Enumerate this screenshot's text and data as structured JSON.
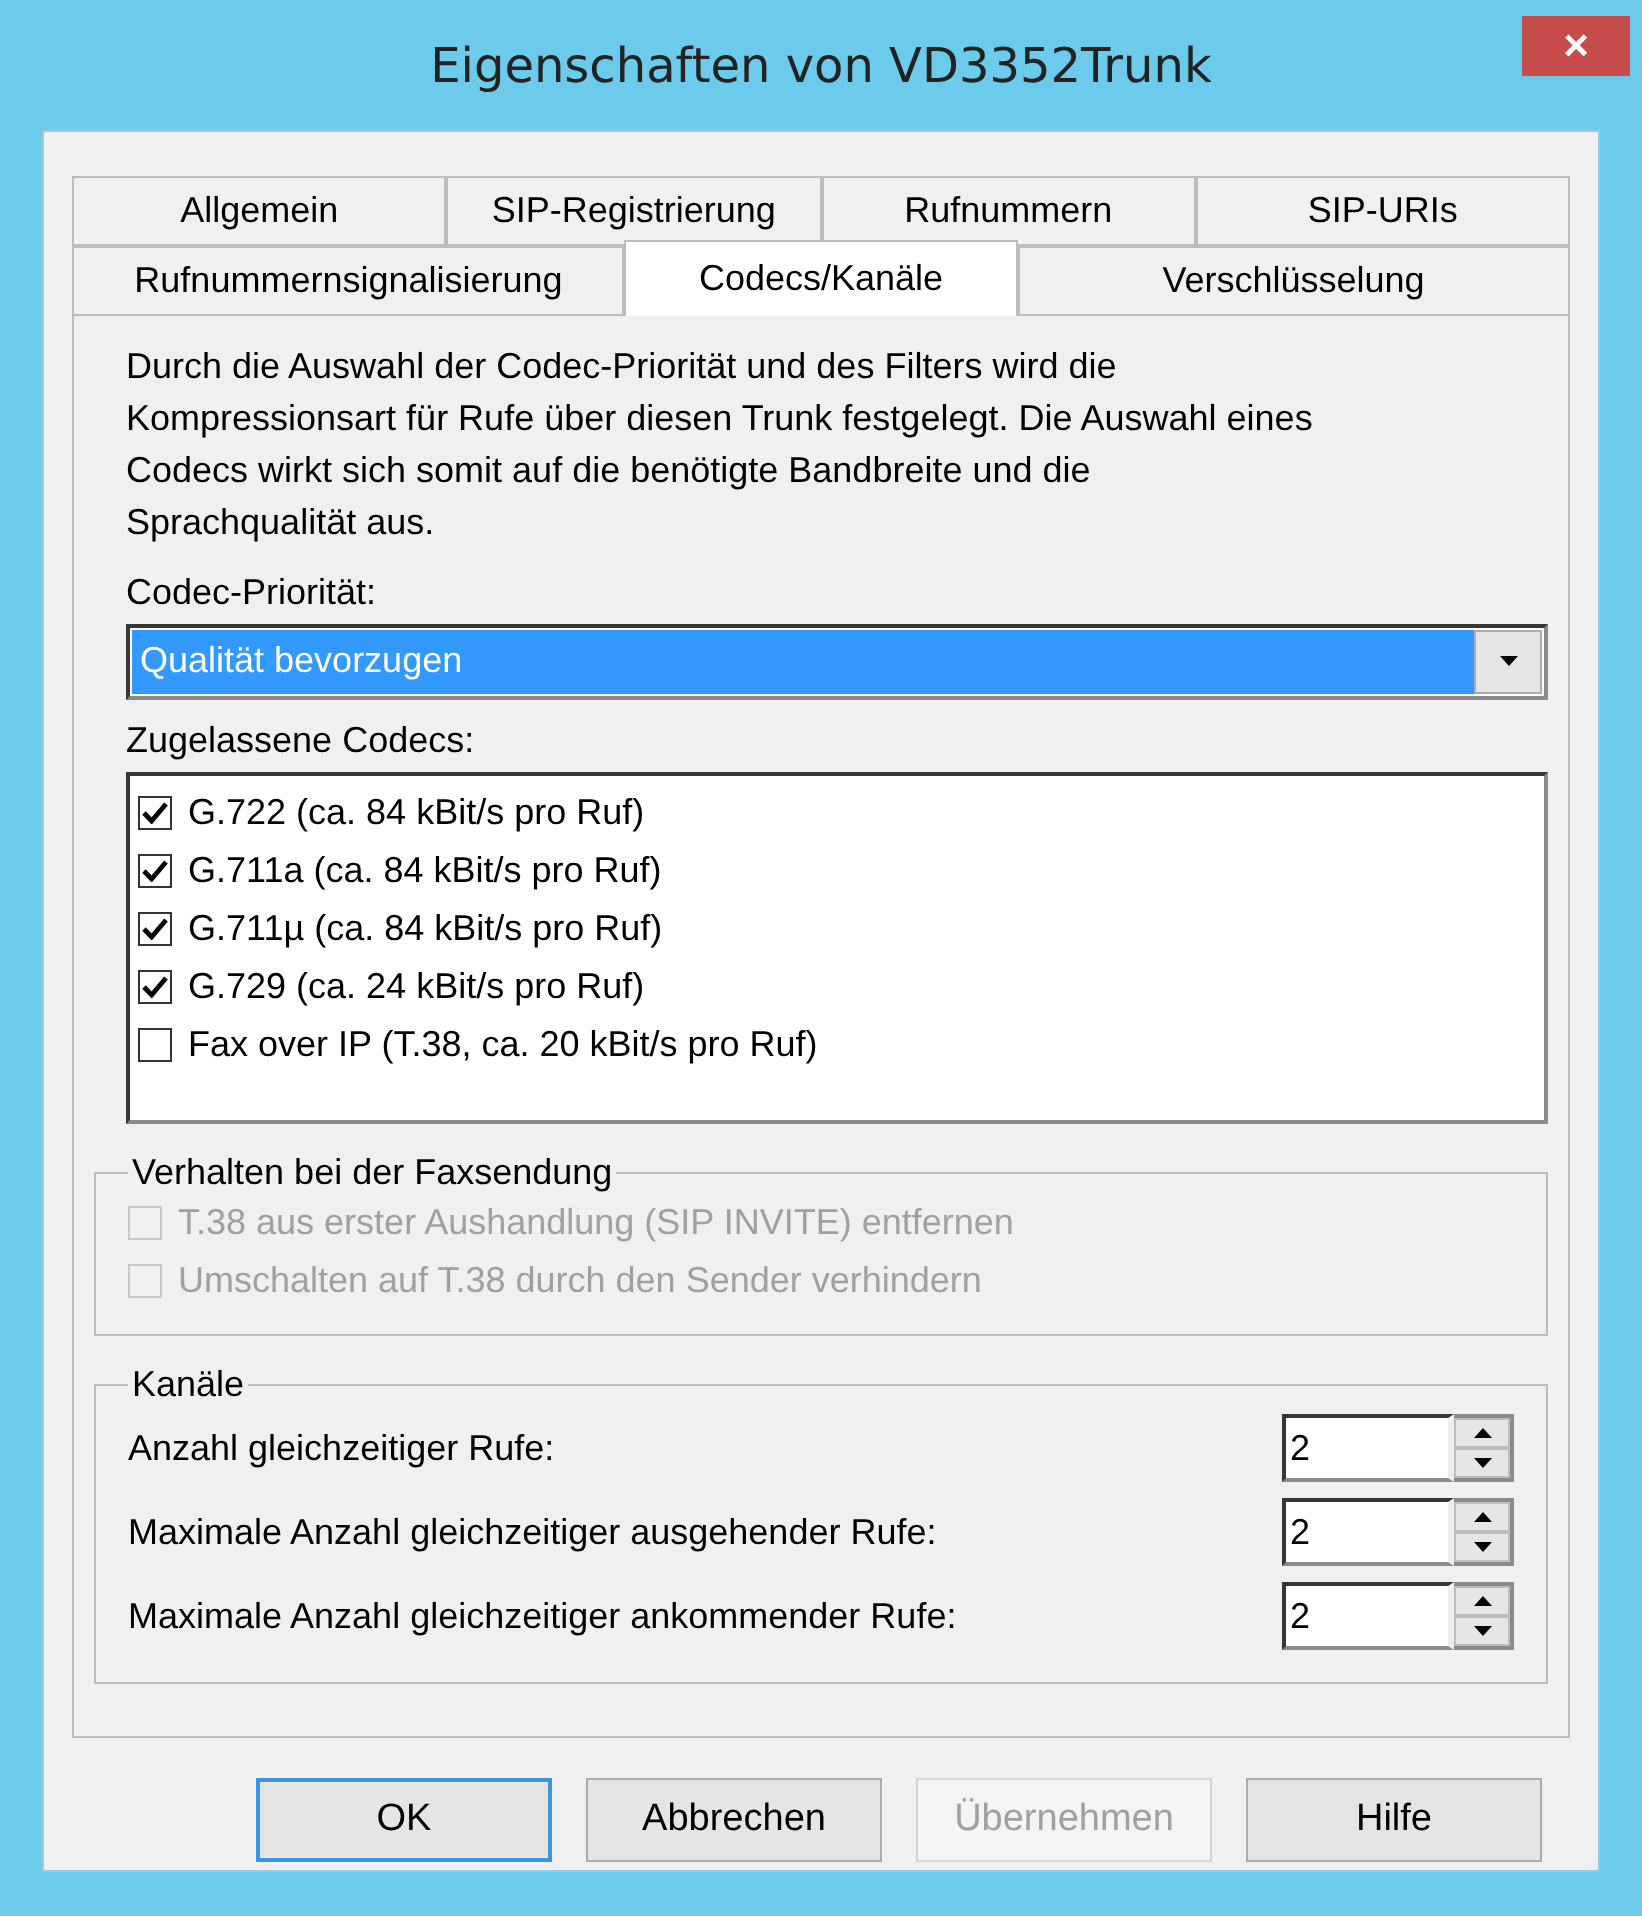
{
  "window": {
    "title": "Eigenschaften von VD3352Trunk",
    "close": "×"
  },
  "tab_rows": [
    [
      {
        "label": "Allgemein",
        "selected": false
      },
      {
        "label": "SIP-Registrierung",
        "selected": false
      },
      {
        "label": "Rufnummern",
        "selected": false
      },
      {
        "label": "SIP-URIs",
        "selected": false
      }
    ],
    [
      {
        "label": "Rufnummernsignalisierung",
        "selected": false
      },
      {
        "label": "Codecs/Kanäle",
        "selected": true
      },
      {
        "label": "Verschlüsselung",
        "selected": false
      }
    ]
  ],
  "description": "Durch die Auswahl der Codec-Priorität und des Filters wird die Kompressionsart für Rufe über diesen Trunk festgelegt. Die Auswahl eines Codecs wirkt sich somit auf die benötigte Bandbreite und die Sprachqualität aus.",
  "codec_priority": {
    "label": "Codec-Priorität:",
    "value": "Qualität bevorzugen"
  },
  "codecs": {
    "label": "Zugelassene Codecs:",
    "items": [
      {
        "label": "G.722 (ca. 84 kBit/s pro Ruf)",
        "checked": true
      },
      {
        "label": "G.711a (ca. 84 kBit/s pro Ruf)",
        "checked": true
      },
      {
        "label": "G.711µ (ca. 84 kBit/s pro Ruf)",
        "checked": true
      },
      {
        "label": "G.729 (ca. 24 kBit/s pro Ruf)",
        "checked": true
      },
      {
        "label": "Fax over IP (T.38, ca. 20 kBit/s pro Ruf)",
        "checked": false
      }
    ]
  },
  "fax": {
    "title": "Verhalten bei der Faxsendung",
    "items": [
      {
        "label": "T.38 aus erster Aushandlung (SIP INVITE) entfernen",
        "checked": false,
        "disabled": true
      },
      {
        "label": "Umschalten auf T.38 durch den Sender verhindern",
        "checked": false,
        "disabled": true
      }
    ]
  },
  "channels": {
    "title": "Kanäle",
    "rows": [
      {
        "label": "Anzahl gleichzeitiger Rufe:",
        "value": "2"
      },
      {
        "label": "Maximale Anzahl gleichzeitiger ausgehender Rufe:",
        "value": "2"
      },
      {
        "label": "Maximale Anzahl gleichzeitiger ankommender Rufe:",
        "value": "2"
      }
    ]
  },
  "buttons": [
    {
      "label": "OK",
      "default": true,
      "disabled": false
    },
    {
      "label": "Abbrechen",
      "default": false,
      "disabled": false
    },
    {
      "label": "Übernehmen",
      "default": false,
      "disabled": true
    },
    {
      "label": "Hilfe",
      "default": false,
      "disabled": false
    }
  ]
}
